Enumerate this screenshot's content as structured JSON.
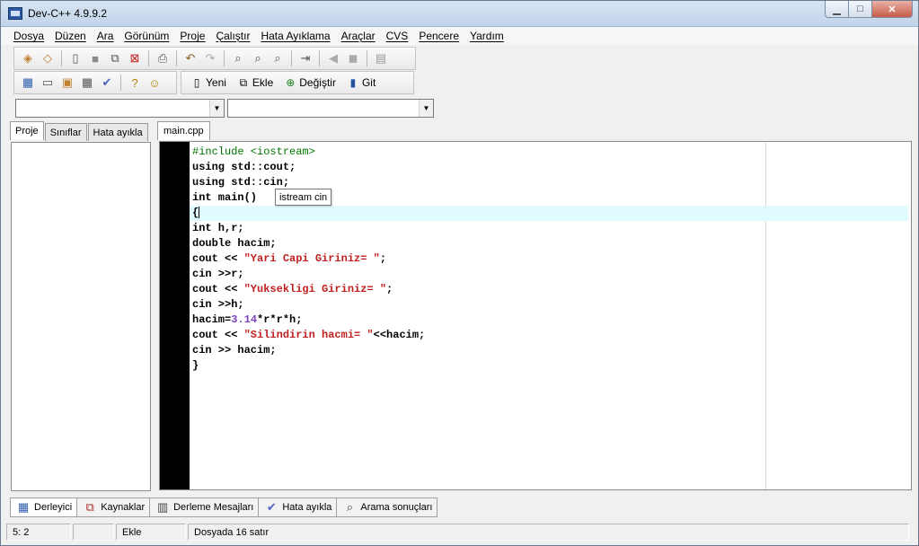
{
  "window": {
    "title": "Dev-C++ 4.9.9.2",
    "minimize_label": "▁",
    "maximize_label": "□",
    "close_label": "✕"
  },
  "menu": [
    "Dosya",
    "Düzen",
    "Ara",
    "Görünüm",
    "Proje",
    "Çalıştır",
    "Hata Ayıklama",
    "Araçlar",
    "CVS",
    "Pencere",
    "Yardım"
  ],
  "toolbar2": {
    "new_label": "Yeni",
    "add_label": "Ekle",
    "change_label": "Değiştir",
    "goto_label": "Git"
  },
  "combos": {
    "class_value": "",
    "member_value": ""
  },
  "left_tabs": [
    "Proje",
    "Sınıflar",
    "Hata ayıkla"
  ],
  "editor": {
    "tab_label": "main.cpp",
    "tooltip": "istream cin",
    "lines": [
      "#include <iostream>",
      "using std::cout;",
      "using std::cin;",
      "int main()",
      "{",
      "int h,r;",
      "double hacim;",
      "cout << \"Yari Capi Giriniz= \";",
      "cin >>r;",
      "cout << \"Yuksekligi Giriniz= \";",
      "cin >>h;",
      "hacim=3.14*r*r*h;",
      "cout << \"Silindirin hacmi= \"<<hacim;",
      "cin >> hacim;",
      "}"
    ]
  },
  "bottom_tabs": [
    "Derleyici",
    "Kaynaklar",
    "Derleme Mesajları",
    "Hata ayıkla",
    "Arama sonuçları"
  ],
  "status": {
    "position": "5: 2",
    "empty": "",
    "mode": "Ekle",
    "info": "Dosyada 16 satır"
  }
}
